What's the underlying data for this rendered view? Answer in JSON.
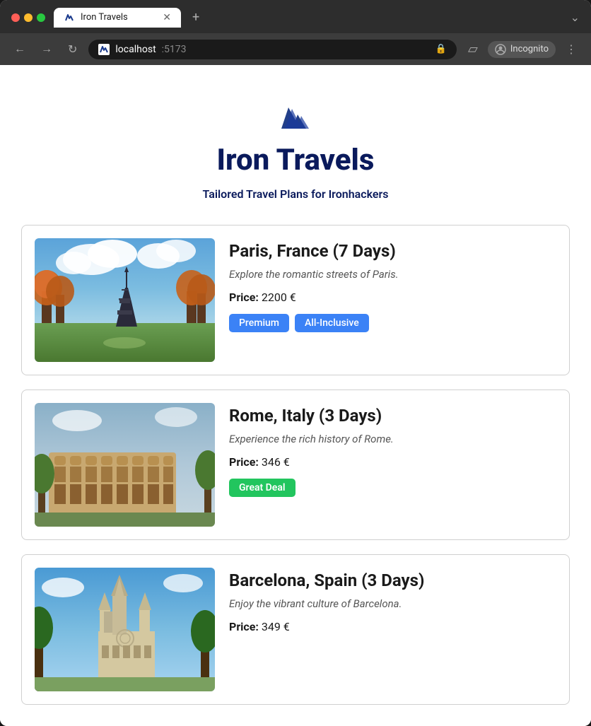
{
  "browser": {
    "tab_title": "Iron Travels",
    "url_host": "localhost",
    "url_port": ":5173",
    "incognito_label": "Incognito",
    "tab_new_label": "+",
    "nav_back": "←",
    "nav_forward": "→",
    "nav_refresh": "↻",
    "nav_menu": "⋮"
  },
  "app": {
    "title": "Iron Travels",
    "subtitle": "Tailored Travel Plans for Ironhackers"
  },
  "destinations": [
    {
      "id": "paris",
      "title": "Paris, France (7 Days)",
      "description": "Explore the romantic streets of Paris.",
      "price_label": "Price:",
      "price": "2200 €",
      "tags": [
        "Premium",
        "All-Inclusive"
      ],
      "tag_types": [
        "premium",
        "all-inclusive"
      ],
      "image_alt": "Paris Eiffel Tower"
    },
    {
      "id": "rome",
      "title": "Rome, Italy (3 Days)",
      "description": "Experience the rich history of Rome.",
      "price_label": "Price:",
      "price": "346 €",
      "tags": [
        "Great Deal"
      ],
      "tag_types": [
        "great-deal"
      ],
      "image_alt": "Rome Colosseum"
    },
    {
      "id": "barcelona",
      "title": "Barcelona, Spain (3 Days)",
      "description": "Enjoy the vibrant culture of Barcelona.",
      "price_label": "Price:",
      "price": "349 €",
      "tags": [],
      "tag_types": [],
      "image_alt": "Barcelona Sagrada Familia"
    }
  ]
}
